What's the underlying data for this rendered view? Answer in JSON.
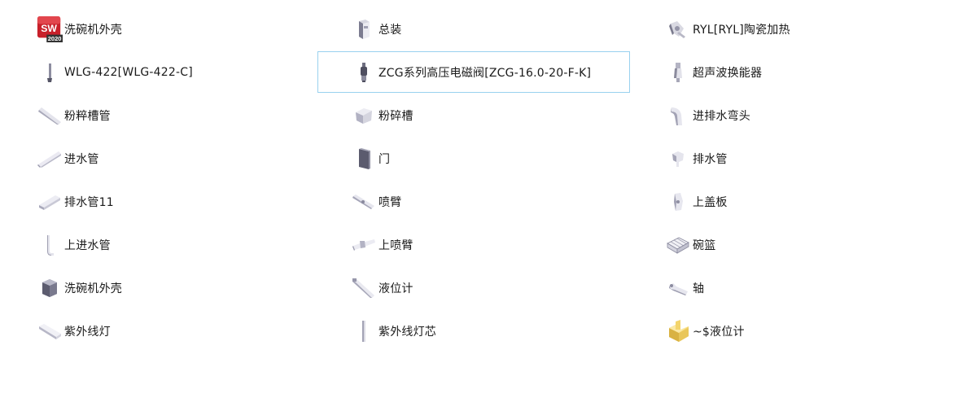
{
  "items": [
    {
      "label": "洗碗机外壳",
      "icon": "solidworks-app-icon"
    },
    {
      "label": "总装",
      "icon": "assembly-part-icon"
    },
    {
      "label": "RYL[RYL]陶瓷加热",
      "icon": "heater-part-icon"
    },
    {
      "label": "WLG-422[WLG-422-C]",
      "icon": "sensor-rod-part-icon"
    },
    {
      "label": "ZCG系列高压电磁阀[ZCG-16.0-20-F-K]",
      "icon": "solenoid-valve-part-icon"
    },
    {
      "label": "超声波换能器",
      "icon": "transducer-part-icon"
    },
    {
      "label": "粉粹槽管",
      "icon": "pipe-part-icon"
    },
    {
      "label": "粉碎槽",
      "icon": "tank-part-icon"
    },
    {
      "label": "进排水弯头",
      "icon": "elbow-part-icon"
    },
    {
      "label": "进水管",
      "icon": "pipe-part-icon"
    },
    {
      "label": "门",
      "icon": "door-part-icon"
    },
    {
      "label": "排水管",
      "icon": "drain-part-icon"
    },
    {
      "label": "排水管11",
      "icon": "pipe-part-icon"
    },
    {
      "label": "喷臂",
      "icon": "spray-arm-part-icon"
    },
    {
      "label": "上盖板",
      "icon": "cover-part-icon"
    },
    {
      "label": "上进水管",
      "icon": "bent-pipe-part-icon"
    },
    {
      "label": "上喷臂",
      "icon": "spray-arm-part-icon"
    },
    {
      "label": "碗篮",
      "icon": "basket-part-icon"
    },
    {
      "label": "洗碗机外壳",
      "icon": "housing-part-icon"
    },
    {
      "label": "液位计",
      "icon": "gauge-part-icon"
    },
    {
      "label": "轴",
      "icon": "shaft-part-icon"
    },
    {
      "label": "紫外线灯",
      "icon": "uv-lamp-part-icon"
    },
    {
      "label": "紫外线灯芯",
      "icon": "lamp-core-part-icon"
    },
    {
      "label": "~$液位计",
      "icon": "temp-file-part-icon"
    }
  ],
  "selected_index": 4,
  "colors": {
    "selection_border": "#99d1ef",
    "text": "#1a1a1a",
    "part_light": "#e9e9ef",
    "part_mid": "#b9b9c6",
    "part_dark": "#6f6f82",
    "sw_red": "#c8202a",
    "temp_yellow": "#f3d46b"
  }
}
